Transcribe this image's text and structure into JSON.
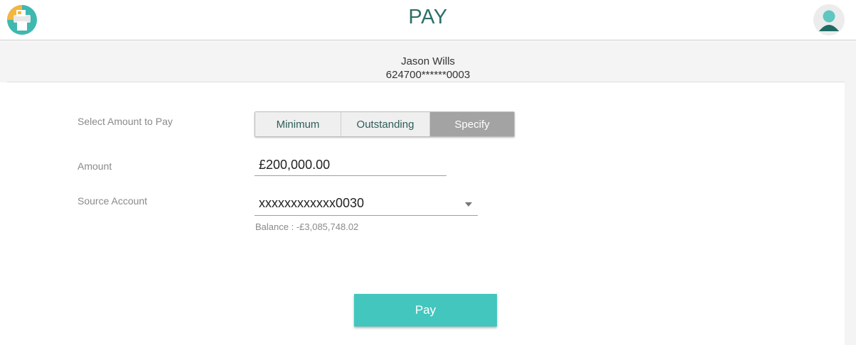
{
  "header": {
    "title": "PAY",
    "logo_icon": "printer-logo-icon",
    "avatar_icon": "user-avatar-icon"
  },
  "card": {
    "holder_name": "Jason Wills",
    "masked_number": "624700******0003"
  },
  "form": {
    "amount_option_label": "Select Amount to Pay",
    "amount_options": [
      "Minimum",
      "Outstanding",
      "Specify"
    ],
    "selected_option": "Specify",
    "amount_label": "Amount",
    "amount_value": "£200,000.00",
    "source_label": "Source Account",
    "source_value": "xxxxxxxxxxxx0030",
    "balance_text": "Balance : -£3,085,748.02"
  },
  "actions": {
    "pay_label": "Pay"
  },
  "colors": {
    "title": "#2e6f6a",
    "accent": "#43c6be",
    "selected_segment": "#a3a3a3"
  }
}
